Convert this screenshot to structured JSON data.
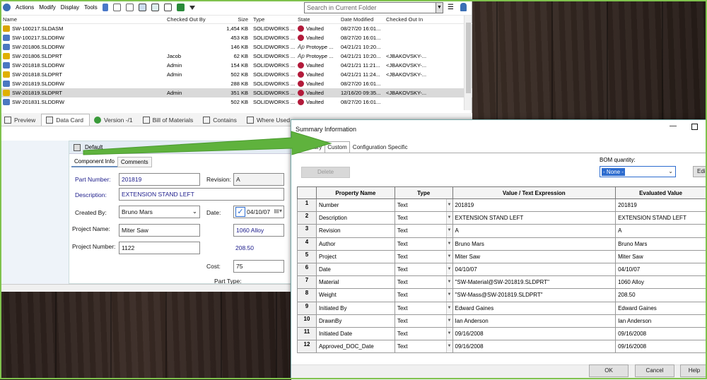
{
  "toolbar": {
    "menus": [
      "Actions",
      "Modify",
      "Display",
      "Tools"
    ],
    "search_placeholder": "Search in Current Folder"
  },
  "filelist": {
    "columns": [
      "Name",
      "Checked Out By",
      "Size",
      "Type",
      "State",
      "Date Modified",
      "Checked Out In"
    ],
    "rows": [
      {
        "name": "SW-100217.SLDASM",
        "by": "",
        "size": "1,454 KB",
        "type": "SOLIDWORKS ...",
        "state": "Vaulted",
        "date": "08/27/20 16:01...",
        "co": ""
      },
      {
        "name": "SW-100217.SLDDRW",
        "by": "",
        "size": "453 KB",
        "type": "SOLIDWORKS ...",
        "state": "Vaulted",
        "date": "08/27/20 16:01...",
        "co": ""
      },
      {
        "name": "SW-201806.SLDDRW",
        "by": "",
        "size": "146 KB",
        "type": "SOLIDWORKS ...",
        "state": "Protoype ...",
        "date": "04/21/21 10:20...",
        "co": ""
      },
      {
        "name": "SW-201806.SLDPRT",
        "by": "Jacob",
        "size": "62 KB",
        "type": "SOLIDWORKS ...",
        "state": "Protoype ...",
        "date": "04/21/21 10:20...",
        "co": "<JBAKOVSKY-..."
      },
      {
        "name": "SW-201818.SLDDRW",
        "by": "Admin",
        "size": "154 KB",
        "type": "SOLIDWORKS ...",
        "state": "Vaulted",
        "date": "04/21/21 11:21...",
        "co": "<JBAKOVSKY-..."
      },
      {
        "name": "SW-201818.SLDPRT",
        "by": "Admin",
        "size": "502 KB",
        "type": "SOLIDWORKS ...",
        "state": "Vaulted",
        "date": "04/21/21 11:24...",
        "co": "<JBAKOVSKY-..."
      },
      {
        "name": "SW-201819.SLDDRW",
        "by": "",
        "size": "288 KB",
        "type": "SOLIDWORKS ...",
        "state": "Vaulted",
        "date": "08/27/20 16:01...",
        "co": ""
      },
      {
        "name": "SW-201819.SLDPRT",
        "by": "Admin",
        "size": "351 KB",
        "type": "SOLIDWORKS ...",
        "state": "Vaulted",
        "date": "12/16/20 09:35...",
        "co": "<JBAKOVSKY-..."
      },
      {
        "name": "SW-201831.SLDDRW",
        "by": "",
        "size": "502 KB",
        "type": "SOLIDWORKS ...",
        "state": "Vaulted",
        "date": "08/27/20 16:01...",
        "co": ""
      }
    ],
    "selected_index": 7
  },
  "tabs": [
    "Preview",
    "Data Card",
    "Version -/1",
    "Bill of Materials",
    "Contains",
    "Where Used"
  ],
  "datacard": {
    "header_label": "Default",
    "tab_component": "Component Info",
    "tab_comments": "Comments",
    "part_number_label": "Part Number:",
    "part_number": "201819",
    "revision_label": "Revision:",
    "revision": "A",
    "description_label": "Description:",
    "description": "EXTENSION STAND LEFT",
    "created_by_label": "Created By:",
    "created_by": "Bruno Mars",
    "date_label": "Date:",
    "date": "04/10/07",
    "project_name_label": "Project Name:",
    "project_name": "Miter Saw",
    "material": "1060 Alloy",
    "project_number_label": "Project Number:",
    "project_number": "1122",
    "weight": "208.50",
    "cost_label": "Cost:",
    "cost": "75",
    "part_type_label": "Part Type:"
  },
  "dialog": {
    "title": "Summary Information",
    "tabs": [
      "Summary",
      "Custom",
      "Configuration Specific"
    ],
    "delete_label": "Delete",
    "bom_label": "BOM quantity:",
    "bom_value": "- None -",
    "edit_label": "Edi",
    "columns": [
      "Property Name",
      "Type",
      "Value / Text Expression",
      "Evaluated Value"
    ],
    "rows": [
      {
        "n": "1",
        "name": "Number",
        "type": "Text",
        "value": "201819",
        "eval": "201819"
      },
      {
        "n": "2",
        "name": "Description",
        "type": "Text",
        "value": "EXTENSION STAND LEFT",
        "eval": "EXTENSION STAND LEFT"
      },
      {
        "n": "3",
        "name": "Revision",
        "type": "Text",
        "value": "A",
        "eval": "A"
      },
      {
        "n": "4",
        "name": "Author",
        "type": "Text",
        "value": "Bruno Mars",
        "eval": "Bruno Mars"
      },
      {
        "n": "5",
        "name": "Project",
        "type": "Text",
        "value": "Miter Saw",
        "eval": "Miter Saw"
      },
      {
        "n": "6",
        "name": "Date",
        "type": "Text",
        "value": "04/10/07",
        "eval": "04/10/07"
      },
      {
        "n": "7",
        "name": "Material",
        "type": "Text",
        "value": "\"SW-Material@SW-201819.SLDPRT\"",
        "eval": "1060 Alloy"
      },
      {
        "n": "8",
        "name": "Weight",
        "type": "Text",
        "value": "\"SW-Mass@SW-201819.SLDPRT\"",
        "eval": "208.50"
      },
      {
        "n": "9",
        "name": "Initiated By",
        "type": "Text",
        "value": "Edward Gaines",
        "eval": "Edward Gaines"
      },
      {
        "n": "10",
        "name": "DrawnBy",
        "type": "Text",
        "value": "Ian Anderson",
        "eval": "Ian Anderson"
      },
      {
        "n": "11",
        "name": "Initiated Date",
        "type": "Text",
        "value": "09/16/2008",
        "eval": "09/16/2008"
      },
      {
        "n": "12",
        "name": "Approved_DOC_Date",
        "type": "Text",
        "value": "09/16/2008",
        "eval": "09/16/2008"
      }
    ],
    "ok_label": "OK",
    "cancel_label": "Cancel",
    "help_label": "Help"
  },
  "colors": {
    "accent": "#2d6ccf",
    "frame": "#7fc24d",
    "vaulted": "#b21a3a"
  }
}
